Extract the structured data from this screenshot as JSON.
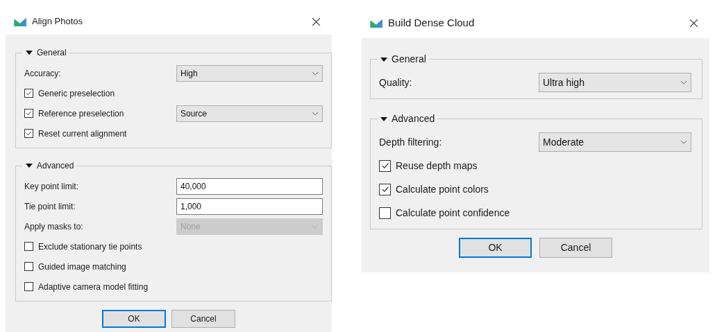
{
  "dialogs": [
    {
      "title": "Align Photos",
      "groups": [
        {
          "title": "General",
          "expanded": true,
          "rows": [
            {
              "kind": "combo",
              "label": "Accuracy:",
              "value": "High",
              "disabled": false
            },
            {
              "kind": "checkbox",
              "label": "Generic preselection",
              "checked": true
            },
            {
              "kind": "checkbox_combo",
              "label": "Reference preselection",
              "checked": true,
              "value": "Source",
              "disabled": false
            },
            {
              "kind": "checkbox",
              "label": "Reset current alignment",
              "checked": true
            }
          ]
        },
        {
          "title": "Advanced",
          "expanded": true,
          "rows": [
            {
              "kind": "field",
              "label": "Key point limit:",
              "value": "40,000"
            },
            {
              "kind": "field",
              "label": "Tie point limit:",
              "value": "1,000"
            },
            {
              "kind": "combo",
              "label": "Apply masks to:",
              "value": "None",
              "disabled": true
            },
            {
              "kind": "checkbox",
              "label": "Exclude stationary tie points",
              "checked": false
            },
            {
              "kind": "checkbox",
              "label": "Guided image matching",
              "checked": false
            },
            {
              "kind": "checkbox",
              "label": "Adaptive camera model fitting",
              "checked": false
            }
          ]
        }
      ],
      "buttons": [
        {
          "label": "OK",
          "focused": true
        },
        {
          "label": "Cancel",
          "focused": false
        }
      ]
    },
    {
      "title": "Build Dense Cloud",
      "groups": [
        {
          "title": "General",
          "expanded": true,
          "rows": [
            {
              "kind": "combo",
              "label": "Quality:",
              "value": "Ultra high",
              "disabled": false
            }
          ]
        },
        {
          "title": "Advanced",
          "expanded": true,
          "rows": [
            {
              "kind": "combo",
              "label": "Depth filtering:",
              "value": "Moderate",
              "disabled": false
            },
            {
              "kind": "checkbox",
              "label": "Reuse depth maps",
              "checked": true
            },
            {
              "kind": "checkbox",
              "label": "Calculate point colors",
              "checked": true
            },
            {
              "kind": "checkbox",
              "label": "Calculate point confidence",
              "checked": false
            }
          ]
        }
      ],
      "buttons": [
        {
          "label": "OK",
          "focused": true
        },
        {
          "label": "Cancel",
          "focused": false
        }
      ]
    }
  ]
}
